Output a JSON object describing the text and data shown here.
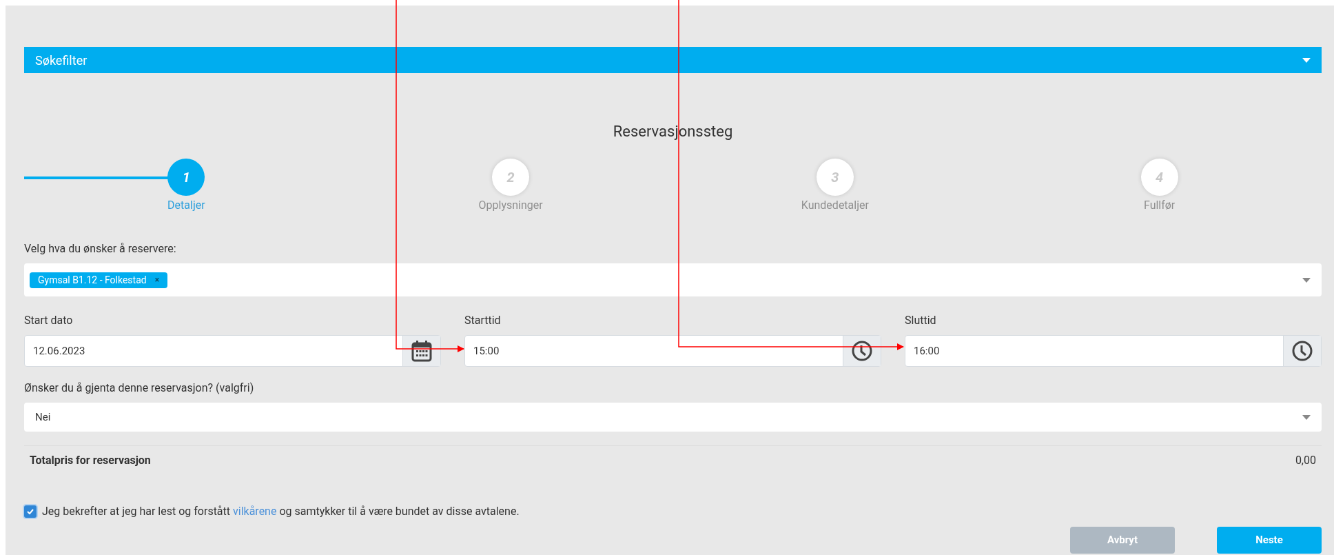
{
  "filter_bar": {
    "title": "Søkefilter"
  },
  "steps_title": "Reservasjonssteg",
  "steps": [
    {
      "number": "1",
      "label": "Detaljer",
      "selected": true
    },
    {
      "number": "2",
      "label": "Opplysninger",
      "selected": false
    },
    {
      "number": "3",
      "label": "Kundedetaljer",
      "selected": false
    },
    {
      "number": "4",
      "label": "Fullfør",
      "selected": false
    }
  ],
  "resource": {
    "label": "Velg hva du ønsker å reservere:",
    "tags": [
      {
        "text": "Gymsal B1.12 - Folkestad",
        "remove": "×"
      }
    ]
  },
  "fields": [
    {
      "label": "Start dato",
      "value": "12.06.2023",
      "kind": "date"
    },
    {
      "label": "Starttid",
      "value": "15:00",
      "kind": "time"
    },
    {
      "label": "Sluttid",
      "value": "16:00",
      "kind": "time"
    }
  ],
  "repeat": {
    "label": "Ønsker du å gjenta denne reservasjon? (valgfri)",
    "value": "Nei"
  },
  "total": {
    "label": "Totalpris for reservasjon",
    "value": "0,00"
  },
  "terms": {
    "checked": true,
    "before": "Jeg bekrefter at jeg har lest og forstått",
    "link": "vilkårene",
    "after": "og samtykker til å være bundet av disse avtalene."
  },
  "buttons": [
    {
      "label": "Avbryt",
      "kind": "secondary"
    },
    {
      "label": "Neste",
      "kind": "primary"
    }
  ]
}
